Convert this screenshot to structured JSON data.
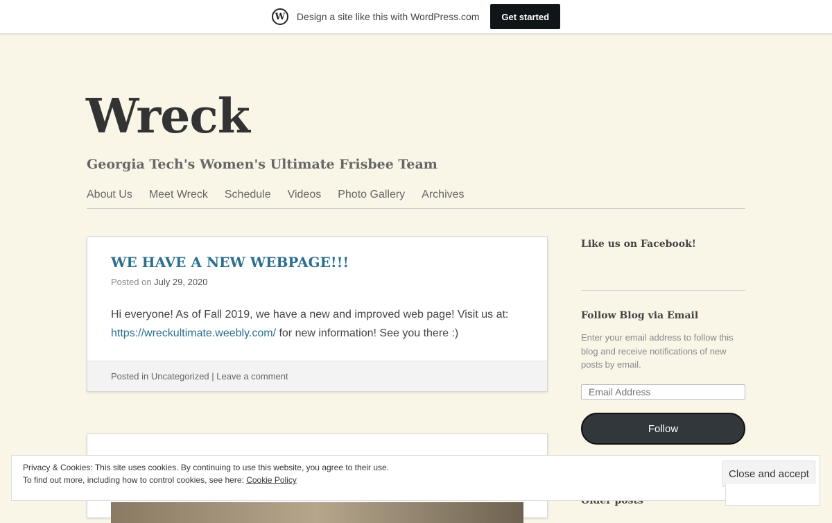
{
  "wpbar": {
    "logo": "W",
    "text": "Design a site like this with WordPress.com",
    "button": "Get started"
  },
  "header": {
    "title": "Wreck",
    "description": "Georgia Tech's Women's Ultimate Frisbee Team"
  },
  "nav": {
    "items": [
      "About Us",
      "Meet Wreck",
      "Schedule",
      "Videos",
      "Photo Gallery",
      "Archives"
    ]
  },
  "post1": {
    "title": "WE HAVE A NEW WEBPAGE!!!",
    "posted_on": "Posted on",
    "date": "July 29, 2020",
    "body_start": "Hi everyone! As of Fall 2019, we have a new and improved web page! Visit us at: ",
    "link": "https://wreckultimate.weebly.com/",
    "body_end": " for new information! See you there :)",
    "posted_in": "Posted in",
    "category": "Uncategorized",
    "separator": "|",
    "comment": "Leave a comment"
  },
  "sidebar": {
    "facebook_title": "Like us on Facebook!",
    "follow_title": "Follow Blog via Email",
    "follow_text": "Enter your email address to follow this blog and receive notifications of new posts by email.",
    "email_placeholder": "Email Address",
    "follow_button": "Follow",
    "older_posts": "Older posts"
  },
  "cookie": {
    "line1": "Privacy & Cookies: This site uses cookies. By continuing to use this website, you agree to their use.",
    "line2": "To find out more, including how to control cookies, see here: ",
    "policy_link": "Cookie Policy",
    "button": "Close and accept"
  }
}
